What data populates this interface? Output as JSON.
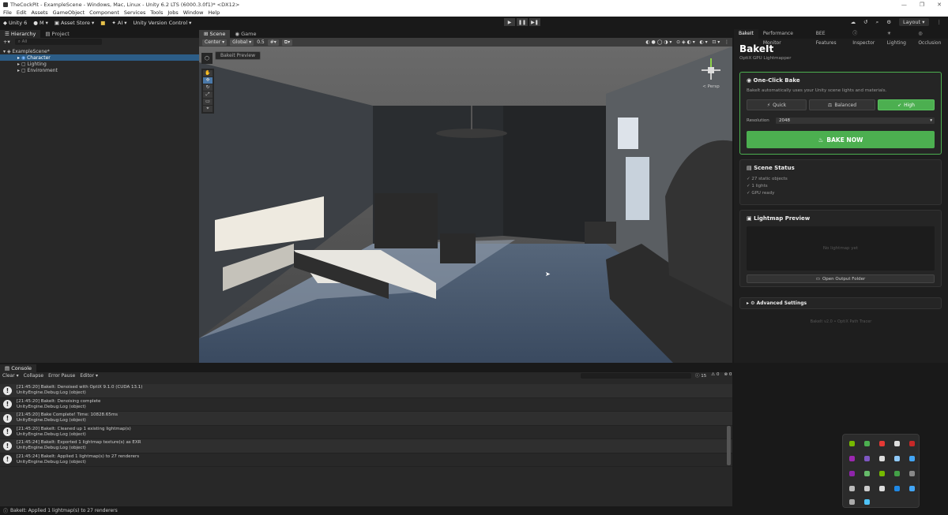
{
  "titlebar": {
    "text": "TheCockPit - ExampleScene - Windows, Mac, Linux - Unity 6.2 LTS (6000.3.0f1)* <DX12>"
  },
  "menu": [
    "File",
    "Edit",
    "Assets",
    "GameObject",
    "Component",
    "Services",
    "Tools",
    "Jobs",
    "Window",
    "Help"
  ],
  "toolbar": {
    "unity": "Unity 6",
    "account": "M",
    "asset_store": "Asset Store",
    "ai": "AI",
    "vcs": "Unity Version Control",
    "layout": "Layout"
  },
  "hierarchy": {
    "tabs": [
      "Hierarchy",
      "Project"
    ],
    "search_placeholder": "All",
    "root": "ExampleScene*",
    "items": [
      "Character",
      "Lighting",
      "Environment"
    ]
  },
  "scene": {
    "tabs": [
      "Scene",
      "Game"
    ],
    "pivot": "Center",
    "space": "Global",
    "snap": "0.5",
    "overlay_label": "Bakeit Preview",
    "persp": "< Persp"
  },
  "right_tabs": [
    "BakeIt",
    "Performance Monitor",
    "BEE Features",
    "Inspector",
    "Lighting",
    "Occlusion"
  ],
  "bakeit": {
    "title": "BakeIt",
    "subtitle": "OptiX GPU Lightmapper",
    "oneclick": {
      "heading": "One-Click Bake",
      "desc": "BakeIt automatically uses your Unity scene lights and materials.",
      "quality": [
        "Quick",
        "Balanced",
        "High"
      ],
      "res_label": "Resolution",
      "res_value": "2048",
      "bake": "BAKE NOW"
    },
    "status": {
      "heading": "Scene Status",
      "lines": [
        "✓ 27 static objects",
        "✓ 1 lights",
        "✓ GPU ready"
      ]
    },
    "preview": {
      "heading": "Lightmap Preview",
      "empty": "No lightmap yet",
      "open": "Open Output Folder"
    },
    "advanced": "Advanced Settings",
    "footer": "BakeIt v2.0 • OptiX Path Tracer"
  },
  "console": {
    "tab": "Console",
    "buttons": [
      "Clear",
      "Collapse",
      "Error Pause",
      "Editor"
    ],
    "counts": [
      "15",
      "0",
      "0"
    ],
    "logs": [
      {
        "l1": "[21:45:20] BakeIt: Denoised with OptiX 9.1.0 (CUDA 13.1)",
        "l2": "UnityEngine.Debug:Log (object)"
      },
      {
        "l1": "[21:45:20] BakeIt: Denoising complete",
        "l2": "UnityEngine.Debug:Log (object)"
      },
      {
        "l1": "[21:45:20] Bake Complete! Time: 10828.65ms",
        "l2": "UnityEngine.Debug:Log (object)"
      },
      {
        "l1": "[21:45:20] BakeIt: Cleaned up 1 existing lightmap(s)",
        "l2": "UnityEngine.Debug:Log (object)"
      },
      {
        "l1": "[21:45:24] BakeIt: Exported 1 lightmap texture(s) as EXR",
        "l2": "UnityEngine.Debug:Log (object)"
      },
      {
        "l1": "[21:45:24] BakeIt: Applied 1 lightmap(s) to 27 renderers",
        "l2": "UnityEngine.Debug:Log (object)"
      }
    ]
  },
  "statusbar": {
    "text": "BakeIt: Applied 1 lightmap(s) to 27 renderers"
  },
  "colors": {
    "accent": "#4caf50",
    "selection": "#2c5d87"
  }
}
